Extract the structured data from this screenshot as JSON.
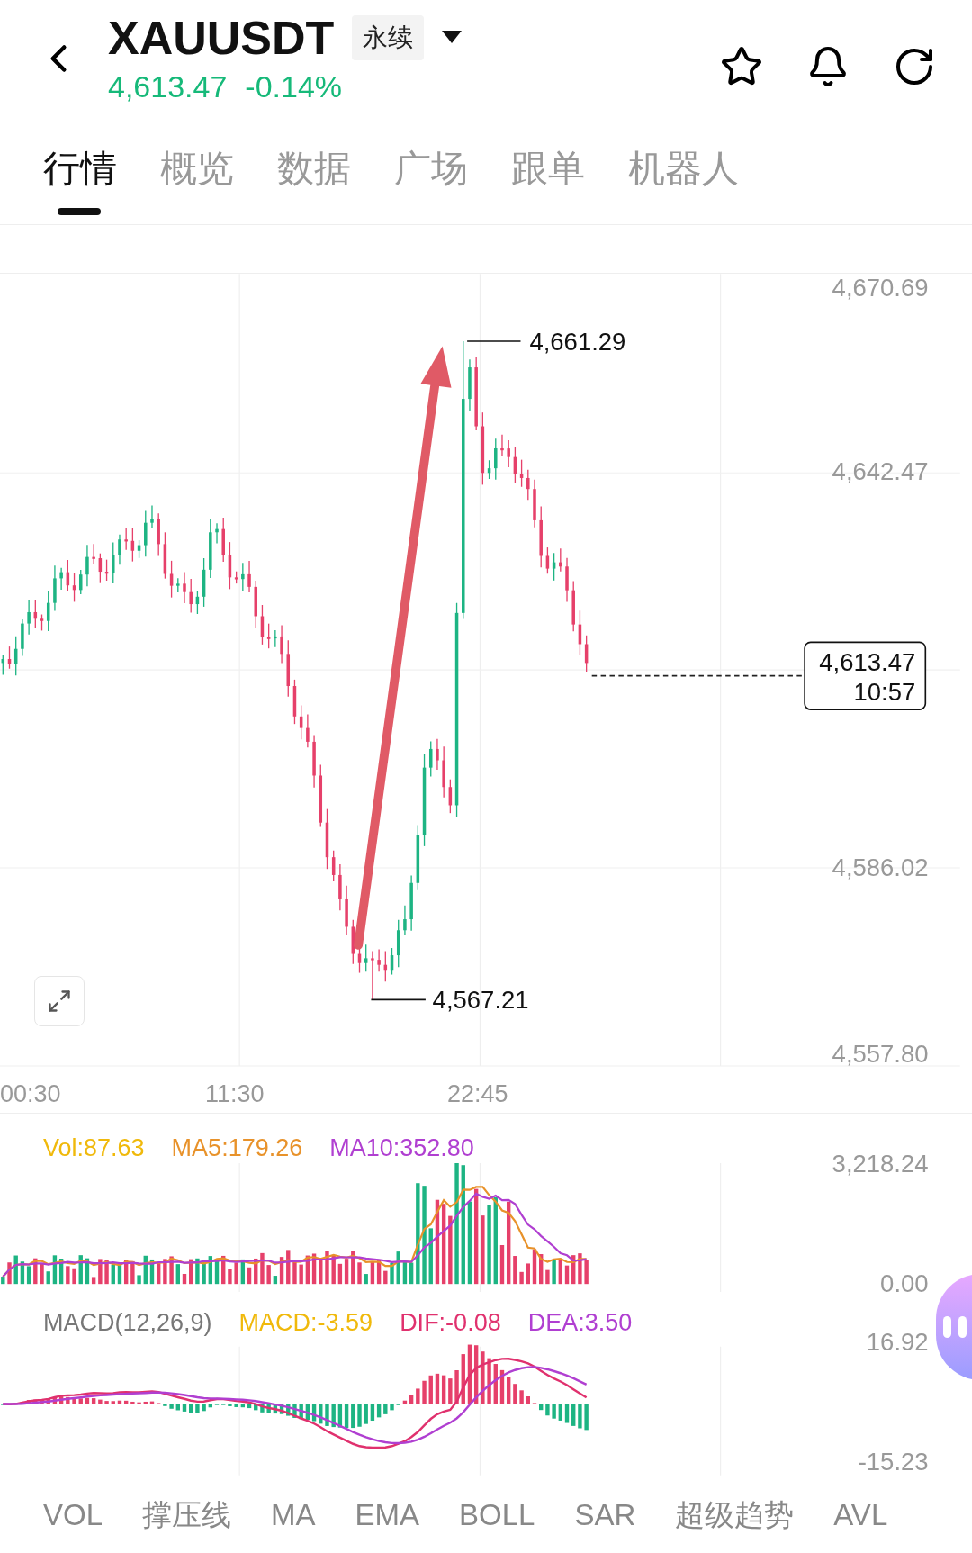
{
  "header": {
    "symbol": "XAUUSDT",
    "contract_type": "永续",
    "price": "4,613.47",
    "change": "-0.14%"
  },
  "tabs": [
    {
      "label": "行情",
      "selected": true
    },
    {
      "label": "概览",
      "selected": false
    },
    {
      "label": "数据",
      "selected": false
    },
    {
      "label": "广场",
      "selected": false
    },
    {
      "label": "跟单",
      "selected": false
    },
    {
      "label": "机器人",
      "selected": false
    }
  ],
  "chart": {
    "y_labels": [
      "4,670.69",
      "4,642.47",
      "4,586.02",
      "4,557.80"
    ],
    "high_label": "4,661.29",
    "low_label": "4,567.21",
    "last_price": "4,613.47",
    "last_time": "10:57",
    "time_labels": [
      "00:30",
      "11:30",
      "22:45"
    ]
  },
  "volume": {
    "legend": [
      {
        "text": "Vol:87.63",
        "color": "#f0b90b"
      },
      {
        "text": "MA5:179.26",
        "color": "#e8922a"
      },
      {
        "text": "MA10:352.80",
        "color": "#b03fd1"
      }
    ],
    "y_labels": [
      "3,218.24",
      "0.00"
    ]
  },
  "macd": {
    "legend": [
      {
        "text": "MACD(12,26,9)",
        "color": "#777777"
      },
      {
        "text": "MACD:-3.59",
        "color": "#f0b90b"
      },
      {
        "text": "DIF:-0.08",
        "color": "#e0316e"
      },
      {
        "text": "DEA:3.50",
        "color": "#b03fd1"
      }
    ],
    "y_labels": [
      "16.92",
      "-15.23"
    ]
  },
  "indicators": [
    "VOL",
    "撑压线",
    "MA",
    "EMA",
    "BOLL",
    "SAR",
    "超级趋势",
    "AVL"
  ]
}
